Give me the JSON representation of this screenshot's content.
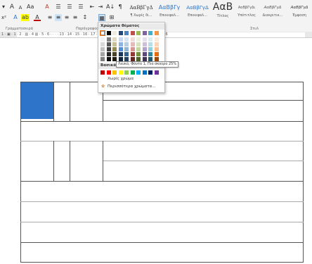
{
  "ribbon": {
    "row1": {
      "font_size_dropdown": "▾",
      "grow_font": "A",
      "shrink_font": "A",
      "change_case": "Aa",
      "clear_format": "A",
      "bullets": "☰",
      "numbering": "☰",
      "multilevel": "☰",
      "decrease_indent": "⇤",
      "increase_indent": "⇥",
      "sort": "A↓",
      "show_marks": "¶"
    },
    "row2": {
      "subscript": "x²",
      "text_effects": "A",
      "highlight": "ab",
      "font_color": "A",
      "align_left": "≡",
      "align_center": "≡",
      "align_right": "≡",
      "justify": "≡",
      "line_spacing": "↕",
      "shading": "▦",
      "borders": "⊞"
    },
    "group_labels": {
      "font": "Γραμματοσειρά",
      "paragraph": "Παράγραφος",
      "styles": "Στυλ"
    },
    "styles": [
      {
        "sample": "AαΒβΓγΔ",
        "name": "¶ Χωρίς δι..."
      },
      {
        "sample": "AαΒβΓγ",
        "name": "Επικεφαλ..."
      },
      {
        "sample": "AαΒβΓγΔ",
        "name": "Επικεφαλ..."
      },
      {
        "sample": "AαB",
        "name": "Τίτλος"
      },
      {
        "sample": "AαΒβΓγΔι",
        "name": "Υπότιτλος"
      },
      {
        "sample": "AαΒβΓγΔ",
        "name": "Διακριτικ..."
      },
      {
        "sample": "AαΒβΓγΔ",
        "name": "Έμφαση"
      }
    ]
  },
  "ruler_text": "1 · ▣ · 1 · 2 · ▥ · 4 ▥ · 5 · 6 · · · · 13 · 14 · 15 · 16 · 17 · 18 · 19 · 20 · 21 · 22 · 23 · 24 · 25 ▥ 26",
  "color_picker": {
    "theme_header": "Χρώματα θέματος",
    "standard_header": "Βασικά χρώματα",
    "no_color": "Χωρίς χρώμα",
    "more_colors": "Περισσότερα χρώματα...",
    "tooltip": "Λευκό, Φόντο 1, Πιο σκούρο 25%",
    "theme_colors": [
      [
        "#ffffff",
        "#000000",
        "#eeece1",
        "#1f497d",
        "#4f81bd",
        "#c0504d",
        "#9bbb59",
        "#8064a2",
        "#4bacc6",
        "#f79646"
      ],
      [
        "#f2f2f2",
        "#7f7f7f",
        "#ddd9c3",
        "#c6d9f0",
        "#dbe5f1",
        "#f2dcdb",
        "#ebf1dd",
        "#e5e0ec",
        "#dbeef3",
        "#fdeada"
      ],
      [
        "#d8d8d8",
        "#595959",
        "#c4bd97",
        "#8db3e2",
        "#b8cce4",
        "#e5b9b7",
        "#d7e3bc",
        "#ccc1d9",
        "#b7dde8",
        "#fbd5b5"
      ],
      [
        "#bfbfbf",
        "#3f3f3f",
        "#938953",
        "#548dd4",
        "#95b3d7",
        "#d99694",
        "#c3d69b",
        "#b2a2c7",
        "#92cddc",
        "#fac08f"
      ],
      [
        "#a5a5a5",
        "#262626",
        "#494429",
        "#17365d",
        "#366092",
        "#953734",
        "#76923c",
        "#5f497a",
        "#31859b",
        "#e36c09"
      ],
      [
        "#7f7f7f",
        "#0c0c0c",
        "#1d1b10",
        "#0f243e",
        "#244061",
        "#632423",
        "#4f6128",
        "#3f3151",
        "#205867",
        "#974806"
      ]
    ],
    "standard_colors": [
      "#c00000",
      "#ff0000",
      "#ffc000",
      "#ffff00",
      "#92d050",
      "#00b050",
      "#00b0f0",
      "#0070c0",
      "#002060",
      "#7030a0"
    ],
    "selected_color": "#ffffff"
  }
}
